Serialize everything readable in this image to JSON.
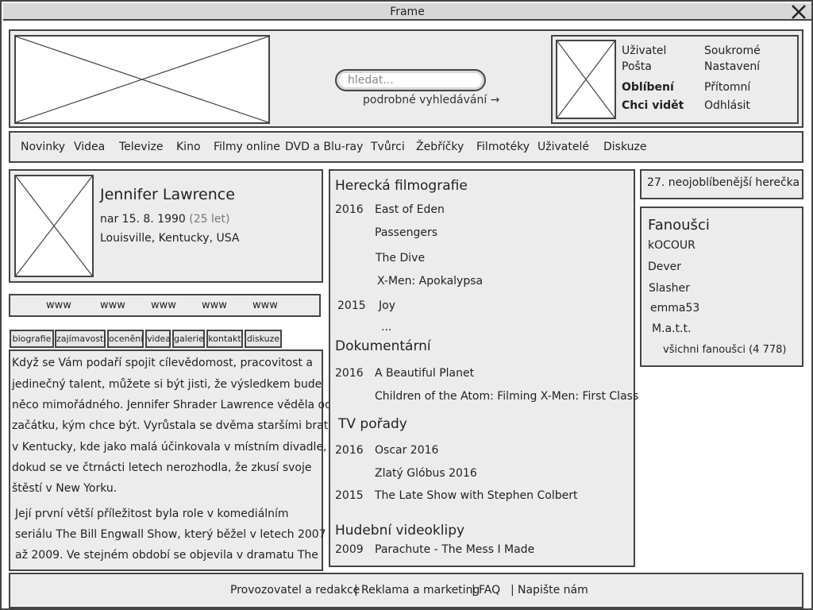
{
  "window": {
    "title": "Frame"
  },
  "search": {
    "placeholder": "hledat...",
    "advanced_link": "podrobné vyhledávání →"
  },
  "user_menu": [
    {
      "label": "Uživatel",
      "bold": false
    },
    {
      "label": "Soukromé",
      "bold": false
    },
    {
      "label": "Pošta",
      "bold": false
    },
    {
      "label": "Nastavení",
      "bold": false
    },
    {
      "label": "Oblíbení",
      "bold": true
    },
    {
      "label": "Přítomní",
      "bold": false
    },
    {
      "label": "Chci vidět",
      "bold": true
    },
    {
      "label": "Odhlásit",
      "bold": false
    }
  ],
  "nav": [
    "Novinky",
    "Videa",
    "Televize",
    "Kino",
    "Filmy online",
    "DVD a Blu-ray",
    "Tvůrci",
    "Žebříčky",
    "Filmotéky",
    "Uživatelé",
    "Diskuze"
  ],
  "profile": {
    "name": "Jennifer Lawrence",
    "born": "nar 15. 8. 1990",
    "age": "(25 let)",
    "place": "Louisville, Kentucky, USA"
  },
  "www_links": [
    "www",
    "www",
    "www",
    "www",
    "www"
  ],
  "tabs": [
    "biografie",
    "zajímavosti",
    "ocenění",
    "videa",
    "galerie",
    "kontakt",
    "diskuze"
  ],
  "bio": {
    "lines": [
      "Když se Vám podaří spojit cílevědomost, pracovitost a",
      "jedinečný talent, můžete si být jisti, že výsledkem bude",
      "něco mimořádného. Jennifer Shrader Lawrence věděla od",
      "začátku, kým chce být. Vyrůstala se dvěma staršími bratry",
      "v Kentucky, kde jako malá účinkovala v místním divadle,",
      "dokud se ve čtrnácti letech nerozhodla, že zkusí svoje",
      "štěstí v New Yorku.",
      "Její první větší příležitost byla role v komediálním",
      "seriálu The Bill Engwall Show, který běžel v letech 2007",
      "až 2009. Ve stejném období se objevila v dramatu The"
    ]
  },
  "filmography": {
    "acting_heading": "Herecká filmografie",
    "acting": [
      {
        "year": "2016",
        "title": "East of Eden"
      },
      {
        "year": "",
        "title": "Passengers"
      },
      {
        "year": "",
        "title": "The Dive"
      },
      {
        "year": "",
        "title": "X-Men: Apokalypsa"
      },
      {
        "year": "2015",
        "title": "Joy"
      },
      {
        "year": "",
        "title": "..."
      }
    ],
    "doc_heading": "Dokumentární",
    "documentary": [
      {
        "year": "2016",
        "title": "A Beautiful Planet"
      },
      {
        "year": "",
        "title": "Children of the Atom: Filming X-Men: First Class"
      }
    ],
    "tv_heading": "TV pořady",
    "tv": [
      {
        "year": "2016",
        "title": "Oscar 2016"
      },
      {
        "year": "",
        "title": "Zlatý Glóbus 2016"
      },
      {
        "year": "2015",
        "title": "The Late Show with Stephen Colbert"
      }
    ],
    "music_heading": "Hudební videoklipy",
    "music": [
      {
        "year": "2009",
        "title": "Parachute - The Mess I Made"
      }
    ]
  },
  "sidebar": {
    "rank": "27. neojoblíbenější herečka",
    "fans_title": "Fanoušci",
    "fans": [
      "kOCOUR",
      "Dever",
      "Slasher",
      "emma53",
      "M.a.t.t."
    ],
    "all_fans": "všichni fanoušci (4 778)"
  },
  "footer": {
    "links": [
      "Provozovatel a redakce",
      "Reklama a marketing",
      "FAQ",
      "Napište nám"
    ],
    "separator": "|"
  }
}
